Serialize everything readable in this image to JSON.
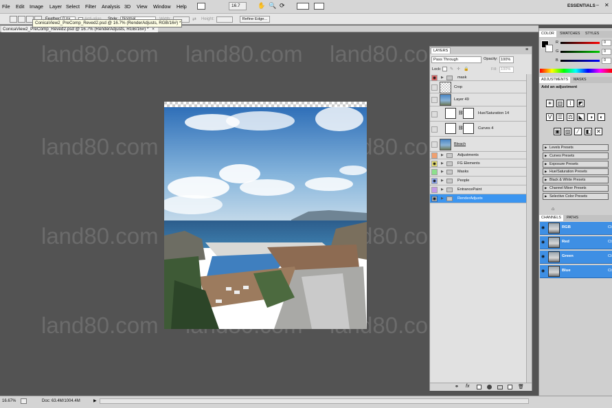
{
  "menubar": {
    "items": [
      "File",
      "Edit",
      "Image",
      "Layer",
      "Select",
      "Filter",
      "Analysis",
      "3D",
      "View",
      "Window",
      "Help"
    ],
    "zoom": "16.7",
    "workspace": "ESSENTIALS"
  },
  "options": {
    "feather_label": "Feather:",
    "feather_value": "0 px",
    "antialias_label": "Anti-alias",
    "style_label": "Style:",
    "style_value": "Normal",
    "width_label": "Width:",
    "height_label": "Height:",
    "refine_edge": "Refine Edge..."
  },
  "document": {
    "tab_title": "ConicaView2_PreComp_Reved2.psd @ 16.7% (RenderAdjusts, RGB/16#) *",
    "tooltip": "ConicaView2_PreComp_Reved2.psd @ 16.7% (RenderAdjusts, RGB/16#) *",
    "watermark": "land80.com"
  },
  "status": {
    "zoom": "16.67%",
    "doc": "Doc: 63.4M/1004.4M"
  },
  "layers": {
    "tab": "LAYERS",
    "blend_mode": "Pass Through",
    "opacity_label": "Opacity:",
    "opacity_value": "100%",
    "lock_label": "Lock:",
    "fill_label": "Fill:",
    "fill_value": "100%",
    "rows": [
      {
        "name": "mask",
        "kind": "group",
        "color": "#e46b6b",
        "eye": true
      },
      {
        "name": "Crop",
        "kind": "layer",
        "color": null,
        "eye": false
      },
      {
        "name": "Layer 49",
        "kind": "layer",
        "color": null,
        "eye": false
      },
      {
        "name": "Hue/Saturation 14",
        "kind": "adjust",
        "color": null,
        "eye": false
      },
      {
        "name": "Curves 4",
        "kind": "adjust",
        "color": null,
        "eye": false
      },
      {
        "name": "Bleach",
        "kind": "layer",
        "color": null,
        "eye": false
      },
      {
        "name": "Adjustments",
        "kind": "group",
        "color": "#f0a070",
        "eye": false
      },
      {
        "name": "FG Elements",
        "kind": "group",
        "color": "#e8e070",
        "eye": true
      },
      {
        "name": "Masks",
        "kind": "group",
        "color": "#8de08d",
        "eye": false
      },
      {
        "name": "People",
        "kind": "group",
        "color": "#8fa9f0",
        "eye": true
      },
      {
        "name": "EntrancePaint",
        "kind": "group",
        "color": "#c49be8",
        "eye": false
      },
      {
        "name": "RenderAdjusts",
        "kind": "group",
        "color": "#a7a7a7",
        "eye": true,
        "selected": true
      }
    ]
  },
  "color_panel": {
    "tabs": [
      "COLOR",
      "SWATCHES",
      "STYLES"
    ],
    "channels": [
      "R",
      "G",
      "B"
    ],
    "values": [
      "0",
      "0",
      "0"
    ]
  },
  "adjustments": {
    "tabs": [
      "ADJUSTMENTS",
      "MASKS"
    ],
    "heading": "Add an adjustment",
    "presets": [
      "Levels Presets",
      "Curves Presets",
      "Exposure Presets",
      "Hue/Saturation Presets",
      "Black & White Presets",
      "Channel Mixer Presets",
      "Selective Color Presets"
    ]
  },
  "channels": {
    "tabs": [
      "CHANNELS",
      "PATHS"
    ],
    "rows": [
      {
        "name": "RGB",
        "shortcut": "Ct"
      },
      {
        "name": "Red",
        "shortcut": "Ct"
      },
      {
        "name": "Green",
        "shortcut": "Ct"
      },
      {
        "name": "Blue",
        "shortcut": "Ct"
      }
    ]
  }
}
